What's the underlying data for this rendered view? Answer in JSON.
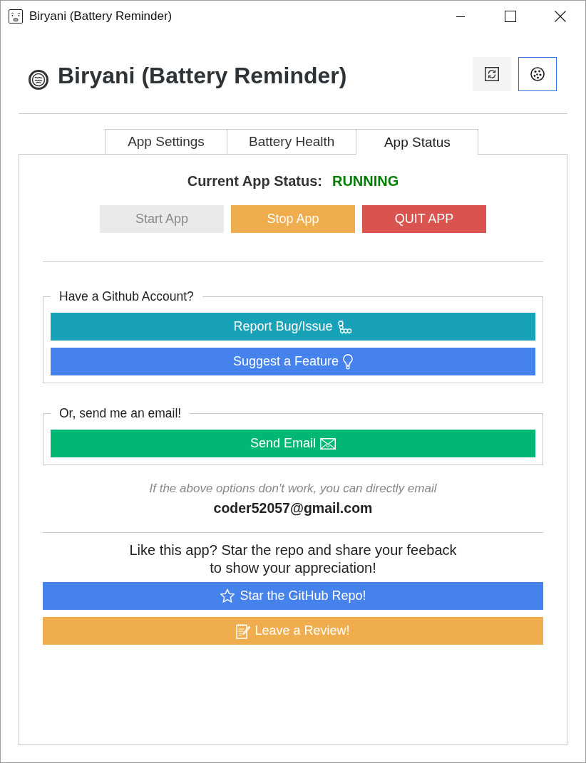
{
  "window": {
    "title": "Biryani (Battery Reminder)"
  },
  "header": {
    "title": "Biryani (Battery Reminder)",
    "buttons": [
      {
        "kind": "refresh",
        "focused": false
      },
      {
        "kind": "theme",
        "focused": true
      }
    ]
  },
  "tabs": [
    {
      "label": "App Settings",
      "selected": false
    },
    {
      "label": "Battery Health",
      "selected": false
    },
    {
      "label": "App Status",
      "selected": true
    }
  ],
  "status": {
    "label": "Current App Status:",
    "value": "RUNNING"
  },
  "controls": [
    {
      "kind": "start",
      "label": "Start App",
      "disabled": true
    },
    {
      "kind": "stop",
      "label": "Stop App",
      "disabled": false
    },
    {
      "kind": "quit",
      "label": "QUIT APP",
      "disabled": false
    }
  ],
  "groups": [
    {
      "legend": "Have a Github Account?",
      "buttons": [
        {
          "kind": "bug",
          "label": "Report Bug/Issue"
        },
        {
          "kind": "idea",
          "label": "Suggest a Feature"
        }
      ]
    },
    {
      "legend": "Or, send me an email!",
      "buttons": [
        {
          "kind": "email",
          "label": "Send Email"
        }
      ]
    }
  ],
  "fallback": {
    "note": "If the above options don't work, you can directly email",
    "email": "coder52057@gmail.com"
  },
  "appreciation": {
    "message": "Like this app? Star the repo and share your feeback\nto show your appreciation!",
    "buttons": [
      {
        "kind": "star",
        "label": "Star the GitHub Repo!"
      },
      {
        "kind": "review",
        "label": "Leave a Review!"
      }
    ]
  }
}
